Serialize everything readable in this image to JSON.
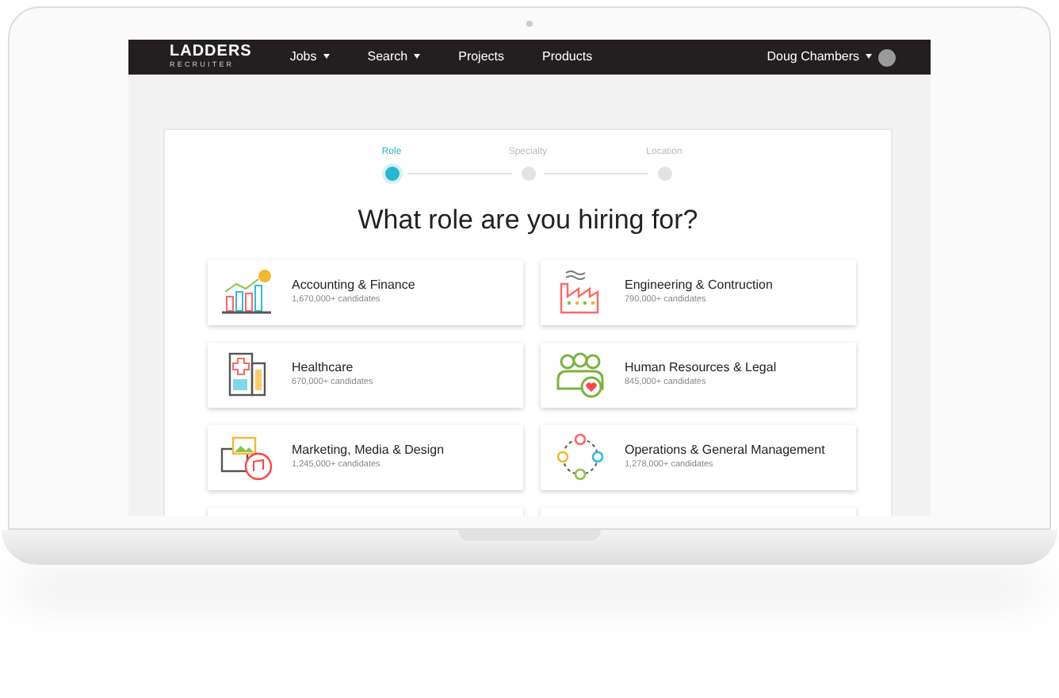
{
  "navbar": {
    "logo": {
      "title": "LADDERS",
      "subtitle": "RECRUITER"
    },
    "menu": [
      {
        "label": "Jobs",
        "dropdown": true
      },
      {
        "label": "Search",
        "dropdown": true
      },
      {
        "label": "Projects",
        "dropdown": false
      },
      {
        "label": "Products",
        "dropdown": false
      }
    ],
    "user": {
      "name": "Doug Chambers",
      "dropdown": true
    }
  },
  "steps": [
    {
      "label": "Role",
      "selected": true
    },
    {
      "label": "Specialty",
      "selected": false
    },
    {
      "label": "Location",
      "selected": false
    }
  ],
  "heading": "What role are you hiring for?",
  "roles": [
    {
      "kind": "finance",
      "title": "Accounting & Finance",
      "count": "1,670,000+ candidates"
    },
    {
      "kind": "factory",
      "title": "Engineering & Contruction",
      "count": "790,000+ candidates"
    },
    {
      "kind": "hospital",
      "title": "Healthcare",
      "count": "670,000+ candidates"
    },
    {
      "kind": "people",
      "title": "Human Resources & Legal",
      "count": "845,000+ candidates"
    },
    {
      "kind": "media",
      "title": "Marketing, Media & Design",
      "count": "1,245,000+ candidates"
    },
    {
      "kind": "network",
      "title": "Operations & General Management",
      "count": "1,278,000+ candidates"
    },
    {
      "kind": "cut"
    },
    {
      "kind": "cut"
    }
  ]
}
